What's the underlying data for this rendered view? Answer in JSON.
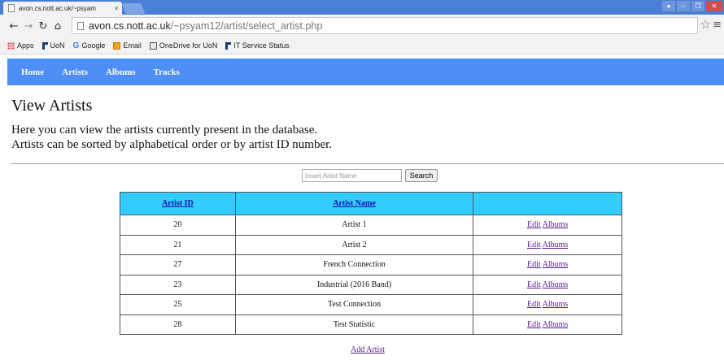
{
  "browser": {
    "tab_title": "avon.cs.nott.ac.uk/~psyam",
    "tab_close": "×",
    "url_host": "avon.cs.nott.ac.uk",
    "url_path": "/~psyam12/artist/select_artist.php",
    "bookmarks": [
      "Apps",
      "UoN",
      "Google",
      "Email",
      "OneDrive for UoN",
      "IT Service Status"
    ]
  },
  "nav": {
    "items": [
      "Home",
      "Artists",
      "Albums",
      "Tracks"
    ]
  },
  "page": {
    "title": "View Artists",
    "intro_line1": "Here you can view the artists currently present in the database.",
    "intro_line2": "Artists can be sorted by alphabetical order or by artist ID number."
  },
  "search": {
    "placeholder": "Insert Artist Name",
    "button": "Search"
  },
  "table": {
    "headers": [
      "Artist ID",
      "Artist Name",
      ""
    ],
    "rows": [
      {
        "id": "20",
        "name": "Artist 1"
      },
      {
        "id": "21",
        "name": "Artist 2"
      },
      {
        "id": "27",
        "name": "French Connection"
      },
      {
        "id": "23",
        "name": "Industrial (2016 Band)"
      },
      {
        "id": "25",
        "name": "Test Connection"
      },
      {
        "id": "28",
        "name": "Test Statistic"
      }
    ],
    "edit_label": "Edit",
    "albums_label": "Albums"
  },
  "add_artist": "Add Artist"
}
